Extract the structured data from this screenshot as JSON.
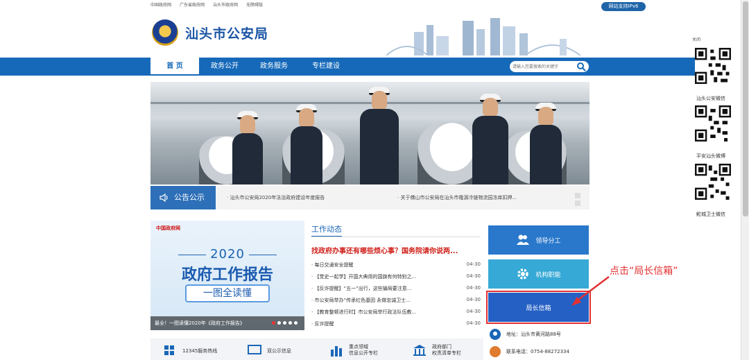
{
  "topbar": {
    "links": [
      "中国政府网",
      "广东省政府网",
      "汕头市政府网",
      "无障碍版"
    ],
    "ipv6": "网站支持IPv6"
  },
  "header": {
    "site_title": "汕头市公安局"
  },
  "nav": {
    "items": [
      "首 页",
      "政务公开",
      "政务服务",
      "专栏建设"
    ],
    "search_placeholder": "请输入您要搜索的关键字"
  },
  "notice": {
    "tag": "公告公示",
    "items": [
      "· 汕头市公安局2020年法治政府建设年度报告",
      "· 关于佛山市公安局在汕头市隆源冷链物流园冻库扣押..."
    ]
  },
  "report": {
    "gov_logo_text": "中国政府网",
    "year": "2020",
    "title": "政府工作报告",
    "subtitle": "一图全读懂",
    "caption": "最全！一图读懂2020年《政府工作报告》"
  },
  "news": {
    "heading": "工作动态",
    "headline": "找政府办事还有哪些烦心事？国务院请你说两...",
    "items": [
      {
        "title": "· 每日交通安全提醒",
        "date": "04-30"
      },
      {
        "title": "· 【党史一起学】开国大典用的国旗有何特别之...",
        "date": "04-30"
      },
      {
        "title": "· 【反诈提醒】“五一”出行，这些骗局要注意...",
        "date": "04-30"
      },
      {
        "title": "· 市公安局举办“传承红色基因 永做忠诚卫士...",
        "date": "04-30"
      },
      {
        "title": "· 【教育整顿进行时】市公安局举行政法队伍教...",
        "date": "04-30"
      },
      {
        "title": "· 反诈提醒",
        "date": "04-30"
      }
    ]
  },
  "quick": {
    "lead": "领导分工",
    "org": "机构职能",
    "mailbox": "局长信箱"
  },
  "annotation": "点击“局长信箱”",
  "contact": {
    "address": "地址：汕头市黄河路88号",
    "phone": "联系电话：0754-88272334"
  },
  "bottom": [
    {
      "label": "12345服务热线"
    },
    {
      "label": "双公示信息"
    },
    {
      "label": "重点领域\n信息公开专栏"
    },
    {
      "label": "政府部门\n权责清单专栏"
    }
  ],
  "float": {
    "close": "关闭",
    "qr_labels": [
      "汕头公安微信",
      "平安汕头微博",
      "鮀城卫士微信"
    ]
  },
  "colors": {
    "brand_blue": "#1669b9",
    "mailbox": "#2561c4",
    "annotation_red": "#e23131"
  }
}
